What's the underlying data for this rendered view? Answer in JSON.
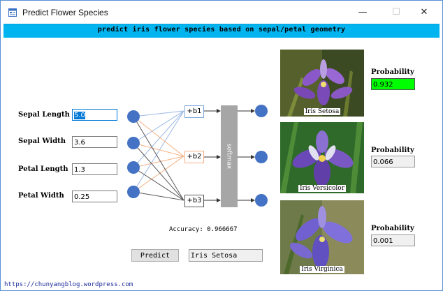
{
  "window": {
    "title": "Predict Flower Species",
    "minimize_glyph": "—",
    "maximize_glyph": "☐",
    "close_glyph": "✕"
  },
  "header": {
    "text": "predict iris flower species based on sepal/petal geometry",
    "color": "#00b4ef"
  },
  "inputs": [
    {
      "label": "Sepal Length",
      "value": "5.0"
    },
    {
      "label": "Sepal Width",
      "value": "3.6"
    },
    {
      "label": "Petal Length",
      "value": "1.3"
    },
    {
      "label": "Petal Width",
      "value": "0.25"
    }
  ],
  "network": {
    "biases": [
      "+b1",
      "+b2",
      "+b3"
    ],
    "softmax_label": "softmax",
    "node_color": "#4472c4"
  },
  "accuracy": "Accuracy: 0.966667",
  "predict_button": "Predict",
  "prediction": "Iris Setosa",
  "outputs": [
    {
      "species": "Iris Setosa",
      "prob_label": "Probability",
      "probability": "0.932",
      "highlight": "#00ff00"
    },
    {
      "species": "Iris Versicolor",
      "prob_label": "Probability",
      "probability": "0.066"
    },
    {
      "species": "Iris Virginica",
      "prob_label": "Probability",
      "probability": "0.001"
    }
  ],
  "footer": "https://chunyangblog.wordpress.com"
}
